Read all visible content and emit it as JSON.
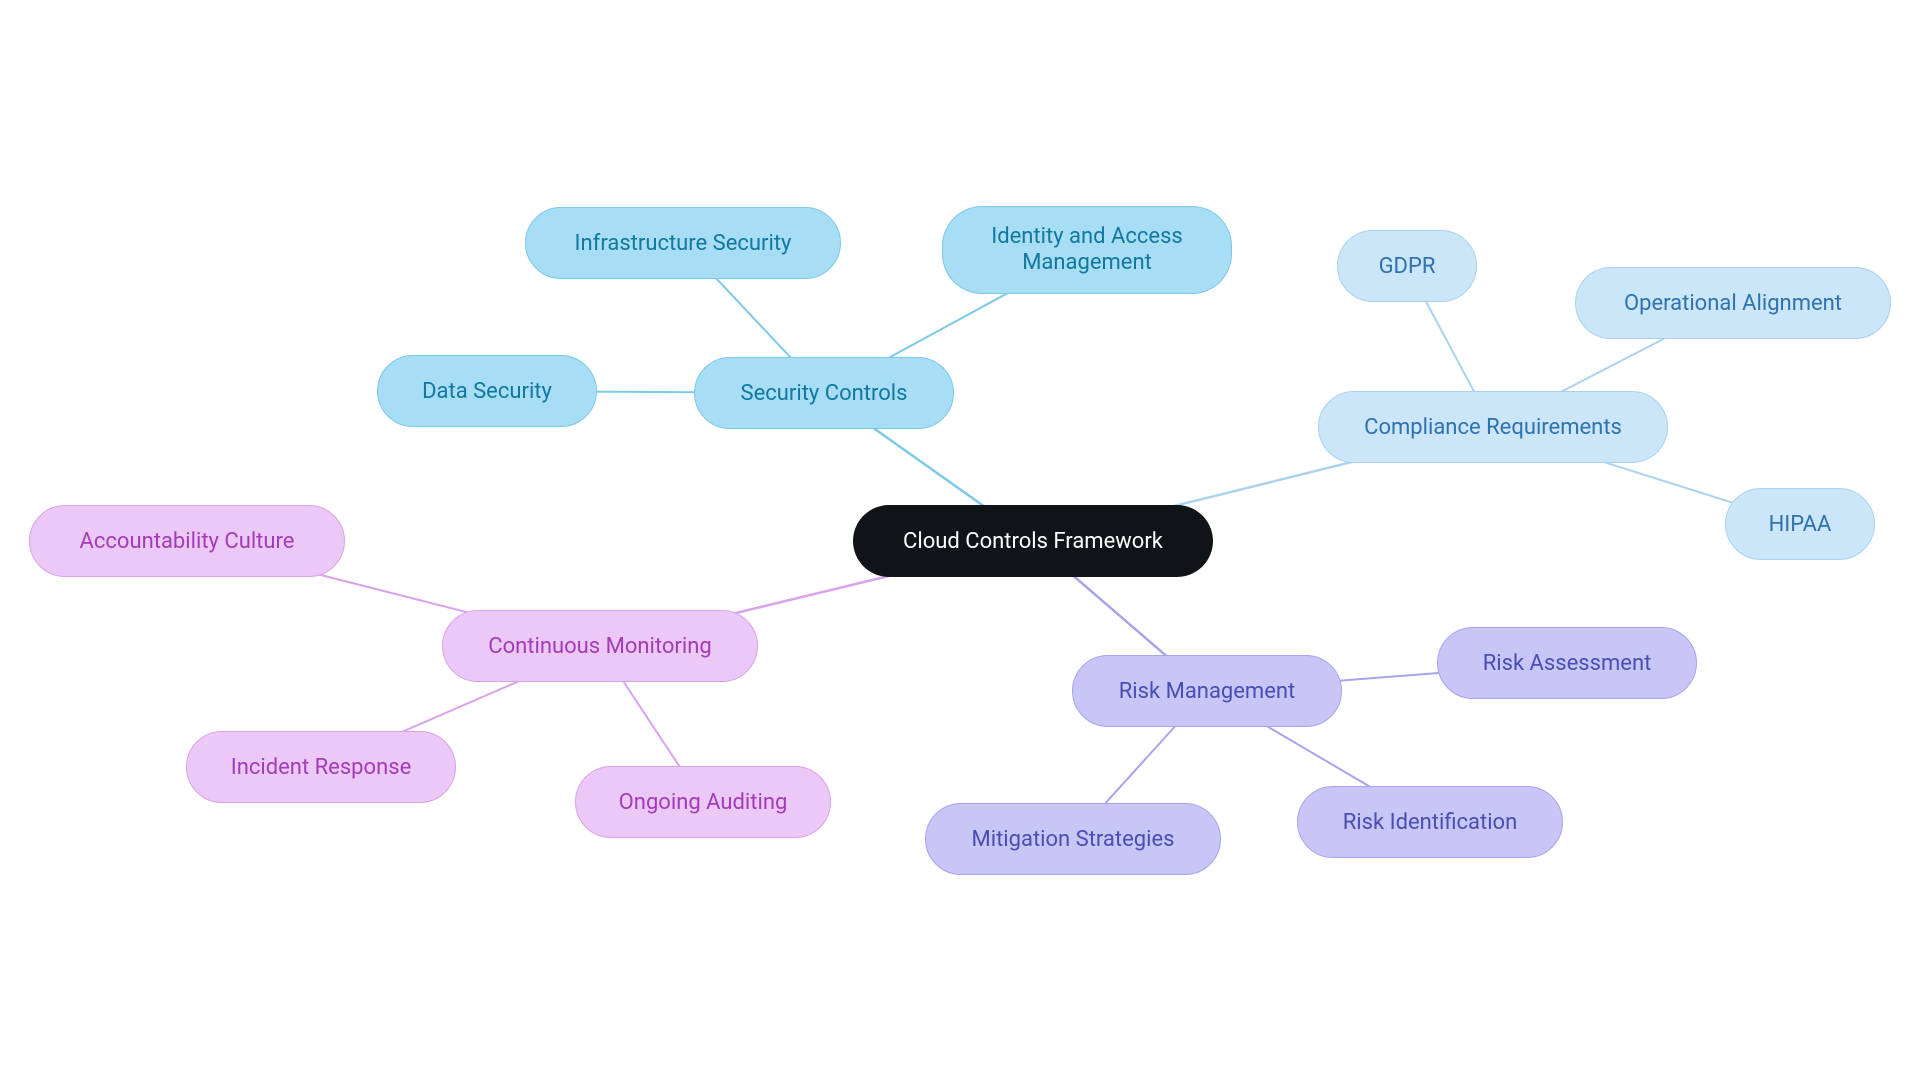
{
  "root": {
    "label": "Cloud Controls Framework"
  },
  "branches": {
    "security": {
      "label": "Security Controls",
      "children": {
        "infra": "Infrastructure Security",
        "iam": "Identity and Access\nManagement",
        "data": "Data Security"
      }
    },
    "compliance": {
      "label": "Compliance Requirements",
      "children": {
        "gdpr": "GDPR",
        "hipaa": "HIPAA",
        "opalign": "Operational Alignment"
      }
    },
    "risk": {
      "label": "Risk Management",
      "children": {
        "assess": "Risk Assessment",
        "ident": "Risk Identification",
        "mitig": "Mitigation Strategies"
      }
    },
    "monitor": {
      "label": "Continuous Monitoring",
      "children": {
        "account": "Accountability Culture",
        "incident": "Incident Response",
        "audit": "Ongoing Auditing"
      }
    }
  },
  "colors": {
    "root": "#0f1419",
    "cyan_fill": "#a7ddf5",
    "cyan_stroke": "#7cc9e8",
    "cyan_text": "#1278a0",
    "lightblue_fill": "#cbe5f9",
    "lightblue_stroke": "#abd2ee",
    "lightblue_text": "#2f72b0",
    "purple_fill": "#c8c6f7",
    "purple_stroke": "#a7a4ec",
    "purple_text": "#4a4db3",
    "pink_fill": "#ebc8f6",
    "pink_stroke": "#d9a3eb",
    "pink_text": "#a33cb8"
  }
}
